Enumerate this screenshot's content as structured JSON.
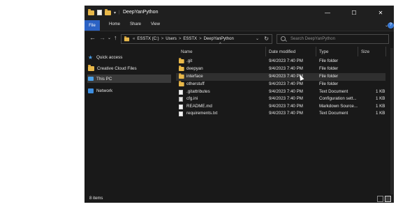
{
  "window": {
    "title": "DeepYanPython",
    "controls": {
      "minimize": "—",
      "maximize": "☐",
      "close": "✕"
    }
  },
  "ribbon": {
    "tabs": [
      "File",
      "Home",
      "Share",
      "View"
    ],
    "expand": "⌄",
    "help": "?"
  },
  "nav": {
    "back": "←",
    "forward": "→",
    "recent": "⌄",
    "up": "↑",
    "breadcrumb": [
      "«",
      "ESSTX (C:)",
      ">",
      "Users",
      ">",
      "ESSTX",
      ">",
      "DeepYanPython"
    ],
    "dropdown": "⌄",
    "refresh": "↻",
    "search_placeholder": "Search DeepYanPython"
  },
  "sidebar": {
    "items": [
      {
        "label": "Quick access",
        "icon": "star-icon"
      },
      {
        "label": "Creative Cloud Files",
        "icon": "folder-icon"
      },
      {
        "label": "This PC",
        "icon": "pc-icon",
        "selected": true
      },
      {
        "label": "Network",
        "icon": "network-icon"
      }
    ]
  },
  "table": {
    "columns": [
      "Name",
      "Date modified",
      "Type",
      "Size"
    ],
    "sort_indicator": "^",
    "rows": [
      {
        "name": ".git",
        "date": "9/4/2023 7:40 PM",
        "type": "File folder",
        "size": "",
        "icon": "folder"
      },
      {
        "name": "deepyan",
        "date": "9/4/2023 7:40 PM",
        "type": "File folder",
        "size": "",
        "icon": "folder"
      },
      {
        "name": "interface",
        "date": "9/4/2023 7:40 PM",
        "type": "File folder",
        "size": "",
        "icon": "folder",
        "hover": true
      },
      {
        "name": "otherstuff",
        "date": "9/4/2023 7:40 PM",
        "type": "File folder",
        "size": "",
        "icon": "folder"
      },
      {
        "name": ".gitattributes",
        "date": "9/4/2023 7:40 PM",
        "type": "Text Document",
        "size": "1 KB",
        "icon": "doc"
      },
      {
        "name": "cfg.ini",
        "date": "9/4/2023 7:40 PM",
        "type": "Configuration sett...",
        "size": "1 KB",
        "icon": "config"
      },
      {
        "name": "README.md",
        "date": "9/4/2023 7:40 PM",
        "type": "Markdown Source...",
        "size": "1 KB",
        "icon": "doc"
      },
      {
        "name": "requirements.txt",
        "date": "9/4/2023 7:40 PM",
        "type": "Text Document",
        "size": "1 KB",
        "icon": "doc"
      }
    ]
  },
  "status": {
    "item_count": "8 items"
  },
  "colors": {
    "window_bg": "#191919",
    "accent": "#2b62c4",
    "folder": "#e8b84a"
  }
}
